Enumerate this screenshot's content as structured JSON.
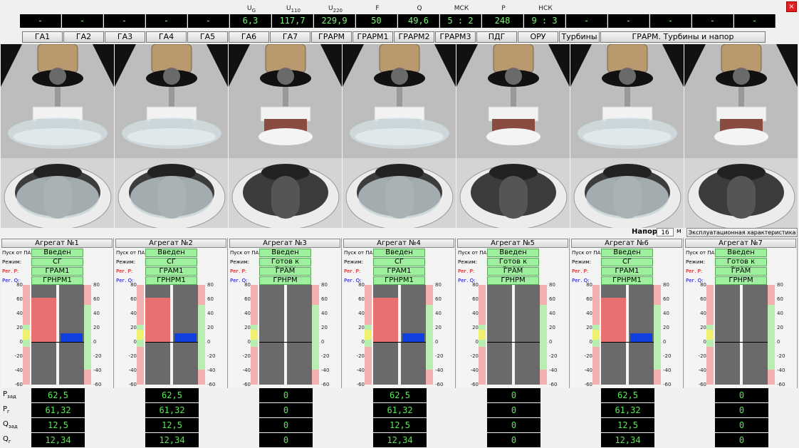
{
  "top": {
    "left_dashes": [
      "-",
      "-",
      "-",
      "-",
      "-"
    ],
    "sensors": [
      {
        "label": "U",
        "sub": "G",
        "value": "6,3"
      },
      {
        "label": "U",
        "sub": "110",
        "value": "117,7"
      },
      {
        "label": "U",
        "sub": "220",
        "value": "229,9"
      },
      {
        "label": "F",
        "sub": "",
        "value": "50"
      },
      {
        "label": "Q",
        "sub": "",
        "value": "49,6"
      },
      {
        "label": "МСК",
        "sub": "",
        "value": "5 : 2"
      },
      {
        "label": "P",
        "sub": "",
        "value": "248"
      },
      {
        "label": "НСК",
        "sub": "",
        "value": "9 : 3"
      }
    ],
    "right_dashes": [
      "-",
      "-",
      "-",
      "-",
      "-"
    ],
    "close": "×"
  },
  "nav": {
    "buttons": [
      "ГА1",
      "ГА2",
      "ГА3",
      "ГА4",
      "ГА5",
      "ГА6",
      "ГА7",
      "ГРАРМ",
      "ГРАРМ1",
      "ГРАРМ2",
      "ГРАРМ3",
      "ПДГ",
      "ОРУ",
      "Турбины",
      "ГРАРМ. Турбины и напор"
    ]
  },
  "napor": {
    "label": "Напор",
    "value": "16",
    "unit": "м",
    "button": "Эксплуатационная характеристика"
  },
  "labels": {
    "start": "Пуск от ПА:",
    "mode": "Режим:",
    "regp": "Рег. P:",
    "regq": "Рег. Q:"
  },
  "ticks": [
    "80",
    "60",
    "40",
    "20",
    "0",
    "-20",
    "-40",
    "-60"
  ],
  "units": [
    {
      "title": "Агрегат №1",
      "start": "Введен",
      "mode": "СГ",
      "regp": "ГРАМ1",
      "regq": "ГРНРМ1",
      "p_level": 62.5,
      "q_level": 12.5,
      "pzad": "62,5",
      "pg": "61,32",
      "qzad": "12,5",
      "qg": "12,34",
      "active": true
    },
    {
      "title": "Агрегат №2",
      "start": "Введен",
      "mode": "СГ",
      "regp": "ГРАМ1",
      "regq": "ГРНРМ1",
      "p_level": 62.5,
      "q_level": 12.5,
      "pzad": "62,5",
      "pg": "61,32",
      "qzad": "12,5",
      "qg": "12,34",
      "active": true
    },
    {
      "title": "Агрегат №3",
      "start": "Введен",
      "mode": "Готов к пуску",
      "regp": "ГРАМ",
      "regq": "ГРНРМ",
      "p_level": 0,
      "q_level": 0,
      "pzad": "0",
      "pg": "0",
      "qzad": "0",
      "qg": "0",
      "active": false
    },
    {
      "title": "Агрегат №4",
      "start": "Введен",
      "mode": "СГ",
      "regp": "ГРАМ1",
      "regq": "ГРНРМ1",
      "p_level": 62.5,
      "q_level": 12.5,
      "pzad": "62,5",
      "pg": "61,32",
      "qzad": "12,5",
      "qg": "12,34",
      "active": true
    },
    {
      "title": "Агрегат №5",
      "start": "Введен",
      "mode": "Готов к пуску",
      "regp": "ГРАМ",
      "regq": "ГРНРМ",
      "p_level": 0,
      "q_level": 0,
      "pzad": "0",
      "pg": "0",
      "qzad": "0",
      "qg": "0",
      "active": false
    },
    {
      "title": "Агрегат №6",
      "start": "Введен",
      "mode": "СГ",
      "regp": "ГРАМ1",
      "regq": "ГРНРМ1",
      "p_level": 62.5,
      "q_level": 12.5,
      "pzad": "62,5",
      "pg": "61,32",
      "qzad": "12,5",
      "qg": "12,34",
      "active": true
    },
    {
      "title": "Агрегат №7",
      "start": "Введен",
      "mode": "Готов к пуску",
      "regp": "ГРАМ",
      "regq": "ГРНРМ",
      "p_level": 0,
      "q_level": 0,
      "pzad": "0",
      "pg": "0",
      "qzad": "0",
      "qg": "0",
      "active": false
    }
  ],
  "bottom_labels": [
    {
      "main": "P",
      "sub": "зад"
    },
    {
      "main": "P",
      "sub": "г"
    },
    {
      "main": "Q",
      "sub": "зад"
    },
    {
      "main": "Q",
      "sub": "г"
    }
  ],
  "colors": {
    "display_bg": "#000000",
    "display_text": "#56e856",
    "bar_red": "#e87070",
    "bar_blue": "#1040e0",
    "field_green": "#9ef09e"
  }
}
